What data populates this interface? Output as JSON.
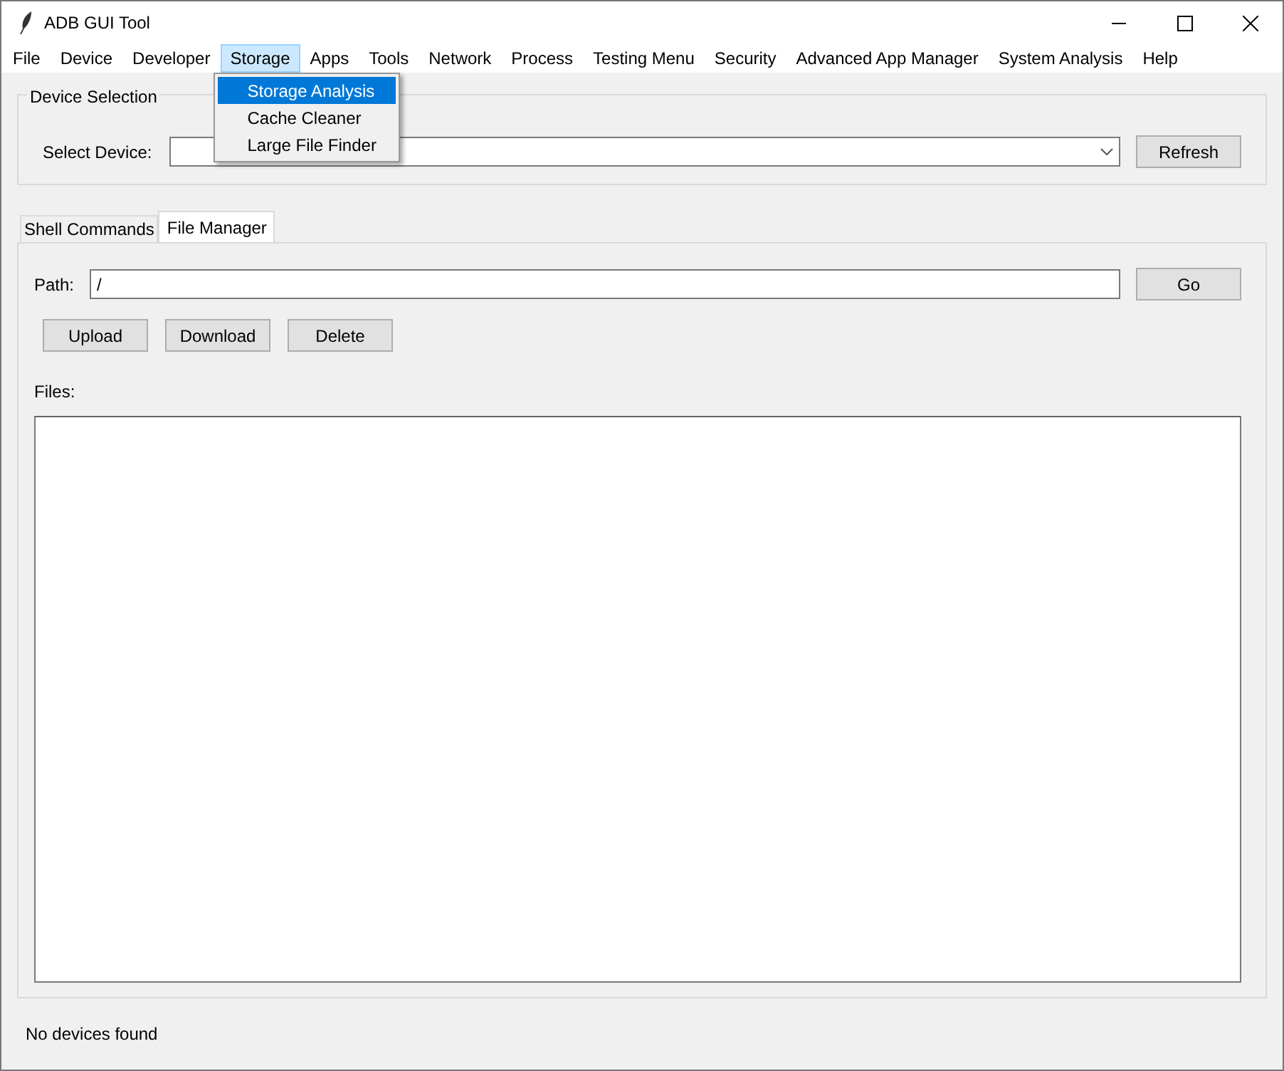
{
  "window": {
    "title": "ADB GUI Tool"
  },
  "menu_bar": [
    {
      "label": "File",
      "selected": false
    },
    {
      "label": "Device",
      "selected": false
    },
    {
      "label": "Developer",
      "selected": false
    },
    {
      "label": "Storage",
      "selected": true
    },
    {
      "label": "Apps",
      "selected": false
    },
    {
      "label": "Tools",
      "selected": false
    },
    {
      "label": "Network",
      "selected": false
    },
    {
      "label": "Process",
      "selected": false
    },
    {
      "label": "Testing Menu",
      "selected": false
    },
    {
      "label": "Security",
      "selected": false
    },
    {
      "label": "Advanced App Manager",
      "selected": false
    },
    {
      "label": "System Analysis",
      "selected": false
    },
    {
      "label": "Help",
      "selected": false
    }
  ],
  "dropdown_menu": [
    {
      "label": "Storage Analysis",
      "selected": true
    },
    {
      "label": "Cache Cleaner",
      "selected": false
    },
    {
      "label": "Large File Finder",
      "selected": false
    }
  ],
  "device_selection": {
    "title": "Device Selection",
    "label": "Select Device:",
    "refresh_button": "Refresh"
  },
  "tabs": [
    {
      "label": "Shell Commands",
      "selected": false
    },
    {
      "label": "File Manager",
      "selected": true
    }
  ],
  "file_manager": {
    "path_label": "Path:",
    "path_value": "/",
    "go_button": "Go",
    "buttons": [
      "Upload",
      "Download",
      "Delete"
    ],
    "files_label": "Files:"
  },
  "status_bar": "No devices found"
}
